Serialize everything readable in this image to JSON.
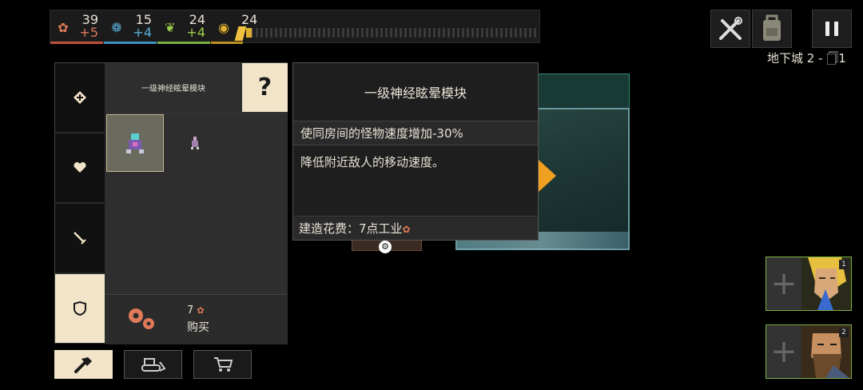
{
  "resources": {
    "industry": {
      "value": "39",
      "delta": "+5",
      "color": "#e07a58",
      "icon": "gears-icon"
    },
    "science": {
      "value": "15",
      "delta": "+4",
      "color": "#5ab0d8",
      "icon": "science-icon"
    },
    "food": {
      "value": "24",
      "delta": "+4",
      "color": "#9ccd4a",
      "icon": "food-leaf-icon"
    },
    "dust": {
      "value": "24",
      "progress": 0.02,
      "color": "#e0b030",
      "icon": "dust-icon"
    }
  },
  "level_label": "地下城 2 - 🗍1",
  "build_panel": {
    "item_title": "一级神经眩晕模块",
    "help_label": "?",
    "buy_cost": "7",
    "buy_label": "购买"
  },
  "tooltip": {
    "title": "一级神经眩晕模块",
    "effect": "使同房间的怪物速度增加-30%",
    "description": "降低附近敌人的移动速度。",
    "cost": "建造花费：7点工业"
  },
  "heroes": [
    {
      "slot": "1"
    },
    {
      "slot": "2"
    }
  ]
}
